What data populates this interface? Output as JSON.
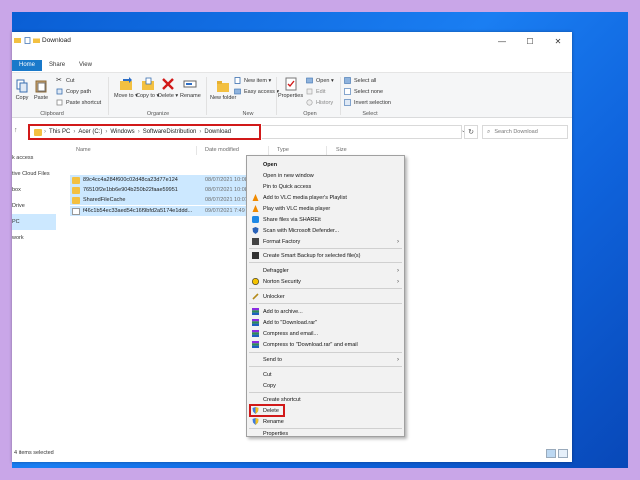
{
  "window": {
    "title": "Download",
    "controls": {
      "minimize": "—",
      "maximize": "☐",
      "close": "✕"
    }
  },
  "ribbon_tabs": [
    "Home",
    "Share",
    "View"
  ],
  "ribbon": {
    "clipboard": {
      "label": "Clipboard",
      "copy": "Copy",
      "paste": "Paste",
      "cut": "Cut",
      "copy_path": "Copy path",
      "paste_shortcut": "Paste shortcut"
    },
    "organize": {
      "label": "Organize",
      "move_to": "Move to ▾",
      "copy_to": "Copy to ▾",
      "delete": "Delete ▾",
      "rename": "Rename"
    },
    "new": {
      "label": "New",
      "new_folder": "New folder",
      "new_item": "New item ▾",
      "easy_access": "Easy access ▾"
    },
    "open": {
      "label": "Open",
      "properties": "Properties",
      "open": "Open ▾",
      "edit": "Edit",
      "history": "History"
    },
    "select": {
      "label": "Select",
      "select_all": "Select all",
      "select_none": "Select none",
      "invert_selection": "Invert selection"
    }
  },
  "address": {
    "crumbs": [
      "This PC",
      "Acer (C:)",
      "Windows",
      "SoftwareDistribution",
      "Download"
    ],
    "search_placeholder": "Search Download"
  },
  "nav_pane": [
    "k access",
    "tive Cloud Files",
    "box",
    "Drive",
    "PC",
    "work"
  ],
  "columns": {
    "name": "Name",
    "date": "Date modified",
    "type": "Type",
    "size": "Size"
  },
  "files": [
    {
      "name": "89c4cc4a284f600c02d48ca23d77e124",
      "date": "08/07/2021 10:08",
      "kind": "folder"
    },
    {
      "name": "76510f2e1bb6e904b250b22faae59951",
      "date": "08/07/2021 10:08",
      "kind": "folder"
    },
    {
      "name": "SharedFileCache",
      "date": "08/07/2021 10:07",
      "kind": "folder"
    },
    {
      "name": "f46c1b54ec33aed54c16f9bfd2a5174e1ddd...",
      "date": "09/07/2021 7:49",
      "kind": "file"
    }
  ],
  "context_menu": [
    {
      "label": "Open",
      "bold": true,
      "icon": ""
    },
    {
      "label": "Open in new window",
      "icon": ""
    },
    {
      "label": "Pin to Quick access",
      "icon": ""
    },
    {
      "label": "Add to VLC media player's Playlist",
      "icon": "vlc-icon"
    },
    {
      "label": "Play with VLC media player",
      "icon": "vlc-icon"
    },
    {
      "label": "Share files via SHAREit",
      "icon": "shareit-icon"
    },
    {
      "label": "Scan with Microsoft Defender...",
      "icon": "defender-icon"
    },
    {
      "label": "Format Factory",
      "icon": "format-factory-icon",
      "submenu": true
    },
    {
      "sep": true
    },
    {
      "label": "Create Smart Backup for selected file(s)",
      "icon": "backup-icon"
    },
    {
      "sep": true
    },
    {
      "label": "Defraggler",
      "icon": "",
      "submenu": true
    },
    {
      "label": "Norton Security",
      "icon": "norton-icon",
      "submenu": true
    },
    {
      "sep": true
    },
    {
      "label": "Unlocker",
      "icon": "unlocker-icon"
    },
    {
      "sep": true
    },
    {
      "label": "Add to archive...",
      "icon": "winrar-icon"
    },
    {
      "label": "Add to \"Download.rar\"",
      "icon": "winrar-icon"
    },
    {
      "label": "Compress and email...",
      "icon": "winrar-icon"
    },
    {
      "label": "Compress to \"Download.rar\" and email",
      "icon": "winrar-icon"
    },
    {
      "sep": true
    },
    {
      "label": "Send to",
      "icon": "",
      "submenu": true
    },
    {
      "sep": true
    },
    {
      "label": "Cut",
      "icon": ""
    },
    {
      "label": "Copy",
      "icon": ""
    },
    {
      "sep": true
    },
    {
      "label": "Create shortcut",
      "icon": ""
    },
    {
      "label": "Delete",
      "icon": "shield-icon",
      "highlight": true
    },
    {
      "label": "Rename",
      "icon": "shield-icon"
    },
    {
      "sep": true
    },
    {
      "label": "Properties",
      "icon": ""
    }
  ],
  "status": {
    "text": "4 items selected"
  },
  "colors": {
    "accent": "#1979ca",
    "selection": "#cce8ff",
    "highlight_box": "#d11919",
    "folder": "#f3c041"
  }
}
